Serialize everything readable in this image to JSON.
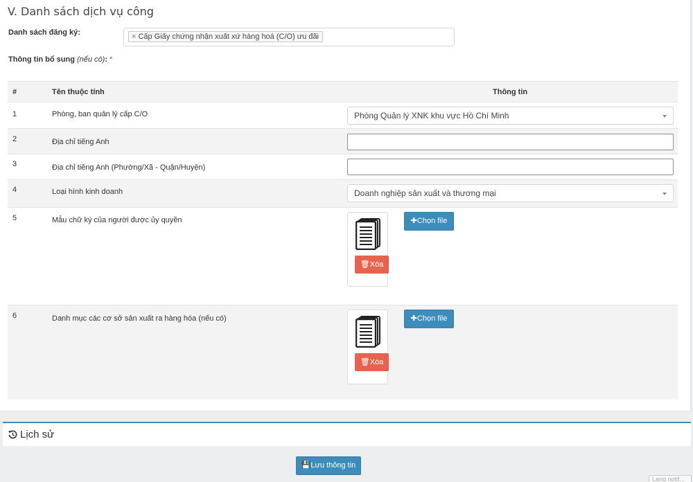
{
  "section": {
    "title": "V. Danh sách dịch vụ công"
  },
  "registration": {
    "label": "Danh sách đăng ký:",
    "tag_remove": "×",
    "tag": "Cấp Giấy chứng nhận xuất xứ hàng hoá (C/O) ưu đãi"
  },
  "extra": {
    "label": "Thông tin bổ sung",
    "note": "(nếu có)",
    "colon": ":",
    "required_mark": "*"
  },
  "table": {
    "headers": {
      "num": "#",
      "name": "Tên thuộc tính",
      "info": "Thông tin"
    },
    "rows": [
      {
        "num": "1",
        "name": "Phòng, ban quản lý cấp C/O",
        "value": "Phòng Quản lý XNK khu vực Hồ Chí Minh"
      },
      {
        "num": "2",
        "name": "Địa chỉ tiếng Anh",
        "value": ""
      },
      {
        "num": "3",
        "name": "Địa chỉ tiếng Anh (Phường/Xã - Quận/Huyện)",
        "value": ""
      },
      {
        "num": "4",
        "name": "Loại hình kinh doanh",
        "value": "Doanh nghiệp sản xuất và thương mại"
      },
      {
        "num": "5",
        "name": "Mẫu chữ ký của người được ủy quyền",
        "delete_label": "Xóa",
        "file_label": "Chọn file"
      },
      {
        "num": "6",
        "name": "Danh mục các cơ sở sản xuất ra hàng hóa (nếu có)",
        "delete_label": "Xóa",
        "file_label": "Chọn file"
      }
    ]
  },
  "history": {
    "title": "Lịch sử"
  },
  "actions": {
    "save_label": "Lưu thông tin"
  },
  "corner": {
    "text": "Lang notif..."
  },
  "colors": {
    "primary": "#3c8dbc",
    "danger": "#e8634f",
    "required": "#dd4b39"
  },
  "icons": [
    "document-icon",
    "trash-icon",
    "plus-icon",
    "history-icon",
    "save-icon",
    "dropdown-caret-icon"
  ]
}
